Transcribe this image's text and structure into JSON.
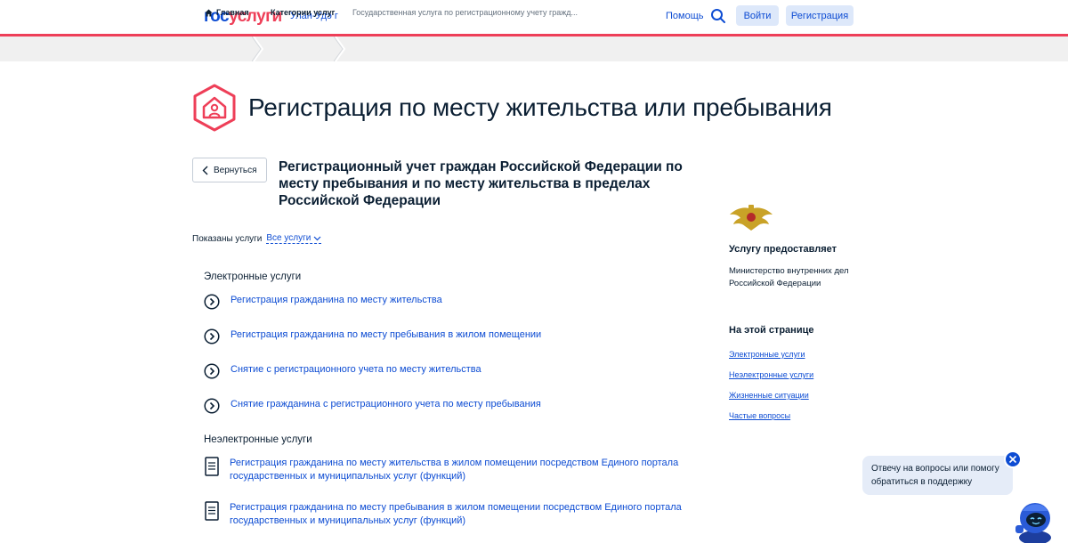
{
  "header": {
    "logo_part1": "гос",
    "logo_part2": "услуги",
    "city": "Улан-Удэ г",
    "help_label": "Помощь",
    "login_label": "Войти",
    "register_label": "Регистрация"
  },
  "breadcrumb": {
    "items": [
      "Главная",
      "Категории услуг",
      "Государственная услуга по регистрационному учету гражд..."
    ]
  },
  "page": {
    "title": "Регистрация по месту жительства или пребывания",
    "back_label": "Вернуться",
    "service_title": "Регистрационный учет граждан Российской Федерации по месту пребывания и по месту жительства в пределах Российской Федерации",
    "filter_label": "Показаны услуги",
    "filter_value": "Все услуги"
  },
  "electronic": {
    "heading": "Электронные услуги",
    "items": [
      "Регистрация гражданина по месту жительства",
      "Регистрация гражданина по месту пребывания в жилом помещении",
      "Снятие с регистрационного учета по месту жительства",
      "Снятие гражданина с регистрационного учета по месту пребывания"
    ]
  },
  "non_electronic": {
    "heading": "Неэлектронные услуги",
    "items": [
      "Регистрация гражданина по месту жительства в жилом помещении посредством Единого портала государственных и муниципальных услуг (функций)",
      "Регистрация гражданина по месту пребывания в жилом помещении посредством Единого портала государственных и муниципальных услуг (функций)"
    ]
  },
  "sidebar": {
    "provider_heading": "Услугу предоставляет",
    "provider_name": "Министерство внутренних дел Российской Федерации",
    "on_page_heading": "На этой странице",
    "links": [
      "Электронные услуги",
      "Неэлектронные услуги",
      "Жизненные ситуации",
      "Частые вопросы"
    ]
  },
  "support": {
    "bubble_text": "Отвечу на вопросы или помогу обратиться в поддержку"
  },
  "colors": {
    "brand_blue": "#0d4cd3",
    "brand_red": "#ee3f58",
    "text_dark": "#0b1f33"
  }
}
